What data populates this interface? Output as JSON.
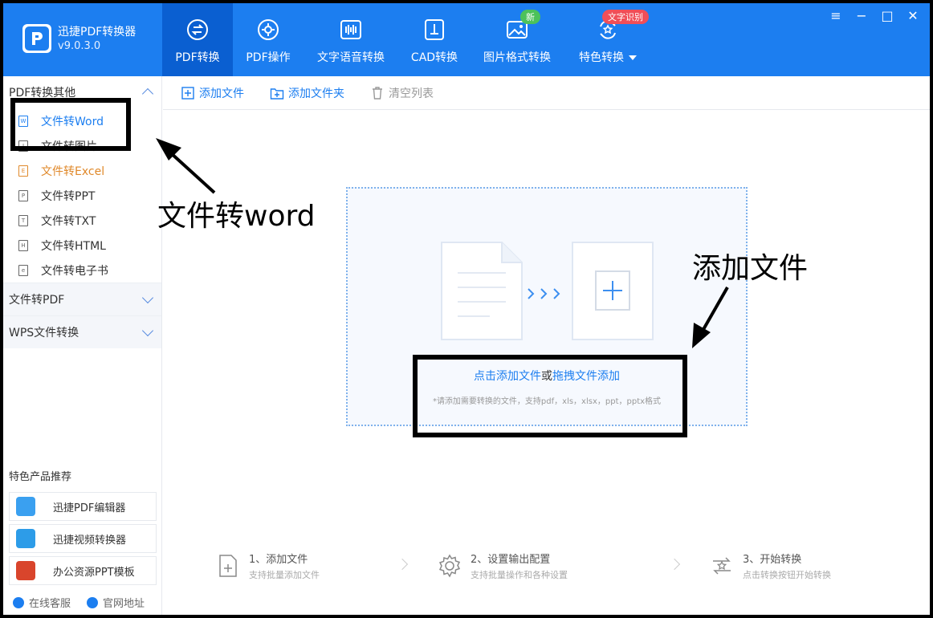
{
  "app": {
    "name": "迅捷PDF转换器",
    "version": "v9.0.3.0"
  },
  "tabs": [
    {
      "label": "PDF转换",
      "icon": "pdf-convert-icon"
    },
    {
      "label": "PDF操作",
      "icon": "pdf-operate-icon"
    },
    {
      "label": "文字语音转换",
      "icon": "audio-wave-icon"
    },
    {
      "label": "CAD转换",
      "icon": "cad-icon"
    },
    {
      "label": "图片格式转换",
      "icon": "image-icon",
      "badge": "新"
    },
    {
      "label": "特色转换",
      "icon": "special-convert-icon",
      "badge": "文字识别"
    }
  ],
  "sidebar": {
    "section1": "PDF转换其他",
    "items": [
      "文件转Word",
      "文件转图片",
      "文件转Excel",
      "文件转PPT",
      "文件转TXT",
      "文件转HTML",
      "文件转电子书"
    ],
    "item_letters": [
      "W",
      "I",
      "E",
      "P",
      "T",
      "H",
      "e"
    ],
    "section2": "文件转PDF",
    "section3": "WPS文件转换",
    "rec_title": "特色产品推荐",
    "rec_items": [
      "迅捷PDF编辑器",
      "迅捷视频转换器",
      "办公资源PPT模板"
    ],
    "footer": [
      "在线客服",
      "官网地址"
    ]
  },
  "toolbar": {
    "add_file": "添加文件",
    "add_folder": "添加文件夹",
    "clear": "清空列表"
  },
  "dropzone": {
    "click_add": "点击添加文件",
    "or": "或",
    "drag_add": "拖拽文件添加",
    "hint": "*请添加需要转换的文件，支持pdf，xls，xlsx，ppt，pptx格式"
  },
  "steps": [
    {
      "title": "1、添加文件",
      "desc": "支持批量添加文件"
    },
    {
      "title": "2、设置输出配置",
      "desc": "支持批量操作和各种设置"
    },
    {
      "title": "3、开始转换",
      "desc": "点击转换按钮开始转换"
    }
  ],
  "annotations": {
    "word": "文件转word",
    "add": "添加文件"
  },
  "colors": {
    "primary": "#1c7ef0",
    "active_tab": "#0a5fd1",
    "excel": "#e0892b"
  }
}
